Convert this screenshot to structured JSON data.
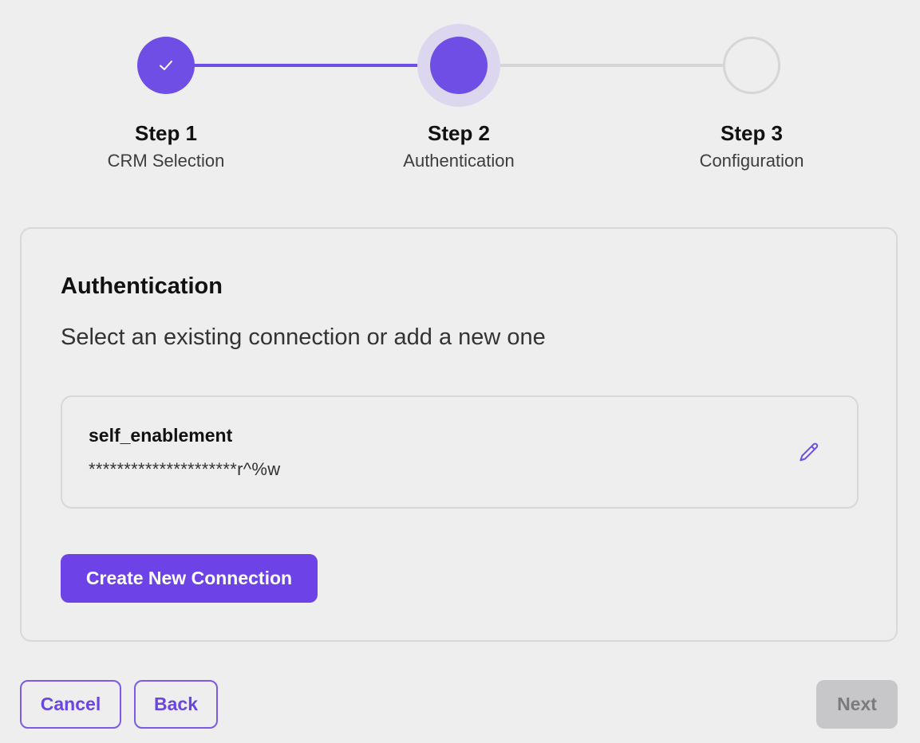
{
  "stepper": {
    "steps": [
      {
        "title": "Step 1",
        "subtitle": "CRM Selection",
        "state": "completed"
      },
      {
        "title": "Step 2",
        "subtitle": "Authentication",
        "state": "active"
      },
      {
        "title": "Step 3",
        "subtitle": "Configuration",
        "state": "pending"
      }
    ]
  },
  "card": {
    "title": "Authentication",
    "subtitle": "Select an existing connection or add a new one",
    "connection": {
      "name": "self_enablement",
      "secret": "*********************r^%w",
      "edit_icon": "pencil-icon"
    },
    "create_label": "Create New Connection"
  },
  "footer": {
    "cancel_label": "Cancel",
    "back_label": "Back",
    "next_label": "Next"
  },
  "colors": {
    "accent": "#6d43e8",
    "completed_step": "#6f4ee6",
    "pending_line": "#d6d6d8",
    "disabled_button": "#c7c7c9"
  }
}
